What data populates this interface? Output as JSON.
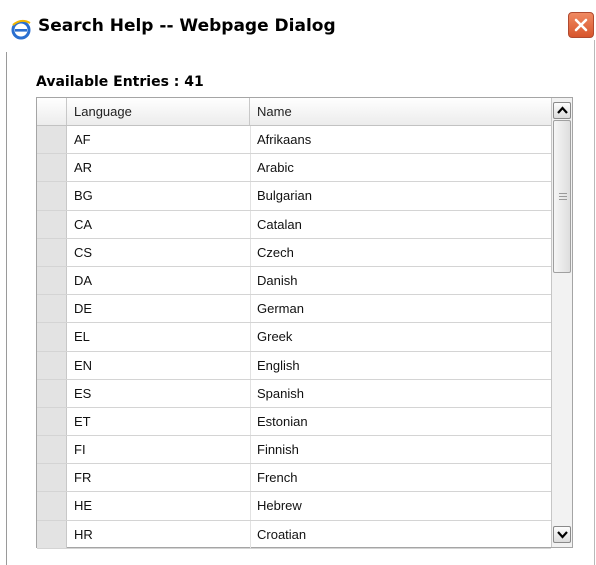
{
  "window": {
    "title": "Search Help -- Webpage Dialog",
    "icon": "internet-explorer-icon",
    "close_icon": "close-icon"
  },
  "summary": {
    "label": "Available Entries : 41"
  },
  "grid": {
    "columns": [
      "Language",
      "Name"
    ],
    "rows": [
      {
        "code": "AF",
        "name": "Afrikaans"
      },
      {
        "code": "AR",
        "name": "Arabic"
      },
      {
        "code": "BG",
        "name": "Bulgarian"
      },
      {
        "code": "CA",
        "name": "Catalan"
      },
      {
        "code": "CS",
        "name": "Czech"
      },
      {
        "code": "DA",
        "name": "Danish"
      },
      {
        "code": "DE",
        "name": "German"
      },
      {
        "code": "EL",
        "name": "Greek"
      },
      {
        "code": "EN",
        "name": "English"
      },
      {
        "code": "ES",
        "name": "Spanish"
      },
      {
        "code": "ET",
        "name": "Estonian"
      },
      {
        "code": "FI",
        "name": "Finnish"
      },
      {
        "code": "FR",
        "name": "French"
      },
      {
        "code": "HE",
        "name": "Hebrew"
      },
      {
        "code": "HR",
        "name": "Croatian"
      }
    ],
    "scroll_position": 0
  },
  "colors": {
    "close_button": "#d8552c",
    "row_selector": "#e3e3e3"
  }
}
